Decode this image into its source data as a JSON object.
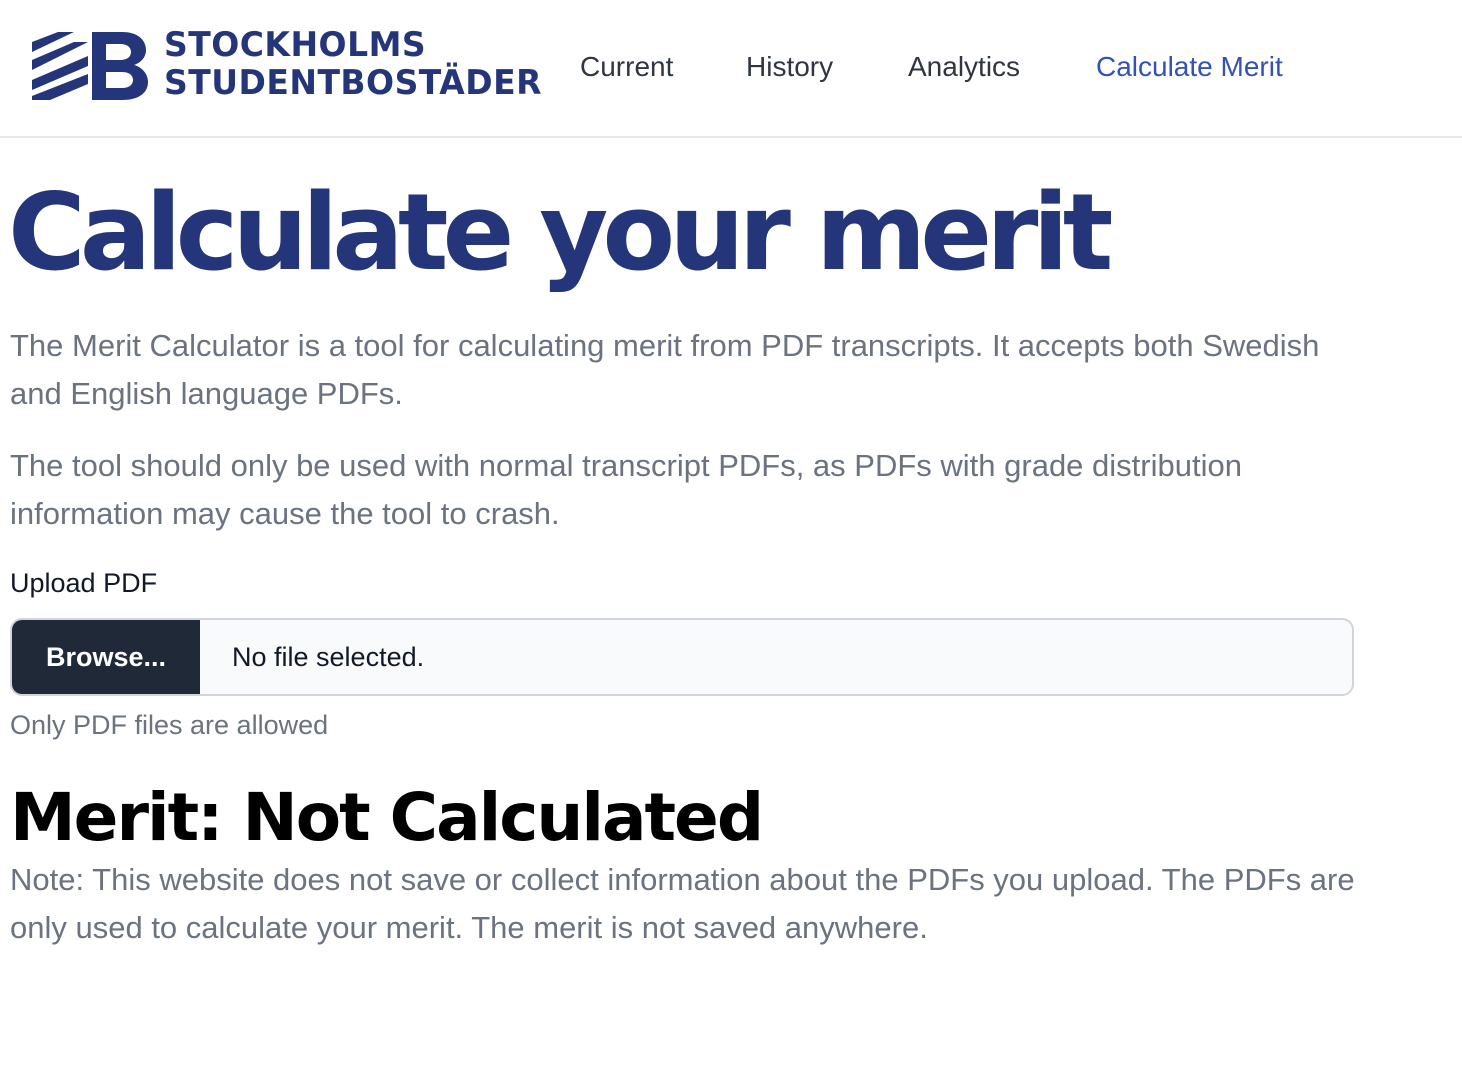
{
  "header": {
    "logo": {
      "line1": "STOCKHOLMS",
      "line2": "STUDENTBOSTÄDER",
      "mark_icon": "sssb-logo-icon"
    },
    "nav": [
      {
        "label": "Current"
      },
      {
        "label": "History"
      },
      {
        "label": "Analytics"
      },
      {
        "label": "Calculate Merit",
        "active": true
      }
    ]
  },
  "main": {
    "title": "Calculate your merit",
    "intro": "The Merit Calculator is a tool for calculating merit from PDF transcripts. It accepts both Swedish and English language PDFs.",
    "warning": "The tool should only be used with normal transcript PDFs, as PDFs with grade distribution information may cause the tool to crash.",
    "upload": {
      "label": "Upload PDF",
      "button_label": "Browse...",
      "status": "No file selected.",
      "helper": "Only PDF files are allowed"
    },
    "merit_heading": "Merit: Not Calculated",
    "note": "Note: This website does not save or collect information about the PDFs you upload. The PDFs are only used to calculate your merit. The merit is not saved anywhere."
  },
  "colors": {
    "brand": "#24357a",
    "active_link": "#3451b8",
    "muted_text": "#6b7280",
    "button_bg": "#1f2937"
  }
}
